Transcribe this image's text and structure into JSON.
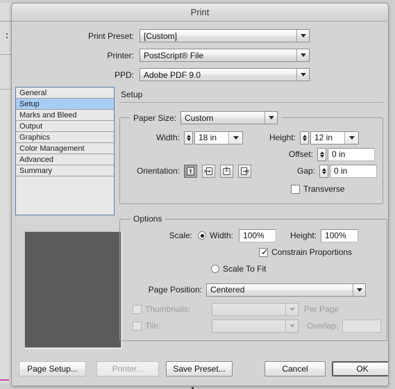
{
  "window": {
    "title": "Print"
  },
  "top_fields": [
    {
      "label": "Print Preset:",
      "value": "[Custom]",
      "icon": "chevron-down-icon"
    },
    {
      "label": "Printer:",
      "value": "PostScript® File",
      "icon": "chevron-down-icon"
    },
    {
      "label": "PPD:",
      "value": "Adobe PDF 9.0",
      "icon": "chevron-down-icon"
    }
  ],
  "sidebar": {
    "items": [
      {
        "label": "General",
        "selected": false
      },
      {
        "label": "Setup",
        "selected": true
      },
      {
        "label": "Marks and Bleed",
        "selected": false
      },
      {
        "label": "Output",
        "selected": false
      },
      {
        "label": "Graphics",
        "selected": false
      },
      {
        "label": "Color Management",
        "selected": false
      },
      {
        "label": "Advanced",
        "selected": false
      },
      {
        "label": "Summary",
        "selected": false
      }
    ],
    "selected_color": "#a8cdf5",
    "border_color": "#5a7fb5"
  },
  "preview": {
    "name": "print-preview-thumbnail",
    "fill_color": "#5b5b5b"
  },
  "panel": {
    "title": "Setup",
    "paper_size": {
      "legend": "Paper Size:",
      "value": "Custom",
      "width": {
        "label": "Width:",
        "value": "18 in"
      },
      "height": {
        "label": "Height:",
        "value": "12 in"
      },
      "offset": {
        "label": "Offset:",
        "value": "0 in"
      },
      "gap": {
        "label": "Gap:",
        "value": "0 in"
      },
      "transverse": {
        "label": "Transverse",
        "checked": false
      },
      "orientation": {
        "label": "Orientation:",
        "buttons": [
          {
            "name": "orientation-portrait-icon",
            "active": true
          },
          {
            "name": "orientation-landscape-icon",
            "active": false
          },
          {
            "name": "orientation-portrait-flipped-icon",
            "active": false
          },
          {
            "name": "orientation-landscape-flipped-icon",
            "active": false
          }
        ]
      }
    },
    "options": {
      "legend": "Options",
      "scale_label": "Scale:",
      "scale_width": {
        "label": "Width:",
        "value": "100%",
        "selected": true
      },
      "scale_height": {
        "label": "Height:",
        "value": "100%"
      },
      "constrain": {
        "label": "Constrain Proportions",
        "checked": true
      },
      "scale_to_fit": {
        "label": "Scale To Fit",
        "selected": false
      },
      "page_position": {
        "label": "Page Position:",
        "value": "Centered"
      },
      "thumbnails": {
        "label": "Thumbnails:",
        "checked": false,
        "value": "",
        "suffix": "Per Page",
        "disabled": true
      },
      "tile": {
        "label": "Tile:",
        "checked": false,
        "value": "",
        "disabled": true
      },
      "overlap": {
        "label": "Overlap:",
        "value": "",
        "disabled": true
      }
    }
  },
  "buttons": {
    "page_setup": "Page Setup...",
    "printer": "Printer...",
    "save_preset": "Save Preset...",
    "cancel": "Cancel",
    "ok": "OK"
  }
}
